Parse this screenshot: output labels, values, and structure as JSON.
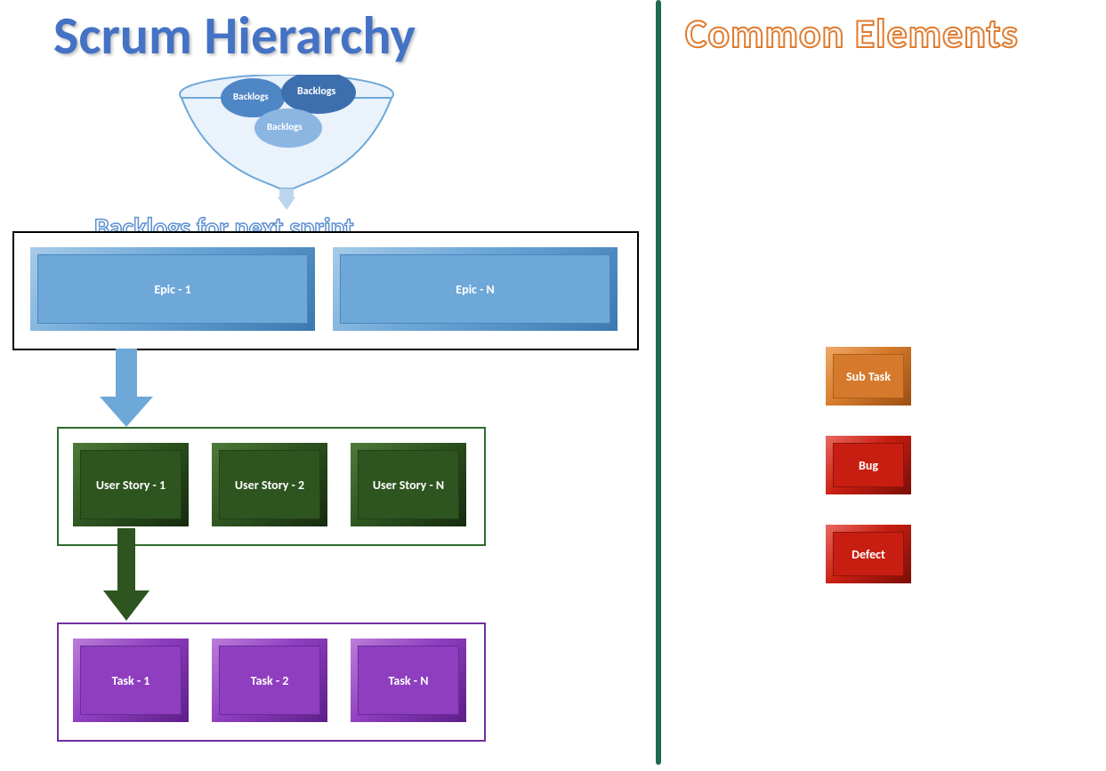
{
  "titles": {
    "left": "Scrum Hierarchy",
    "right": "Common Elements"
  },
  "funnel": {
    "b1": "Backlogs",
    "b2": "Backlogs",
    "b3": "Backlogs"
  },
  "labels": {
    "backlogs_line": "Backlogs for next sprint"
  },
  "epics": {
    "e1": "Epic - 1",
    "eN": "Epic - N"
  },
  "stories": {
    "s1": "User Story - 1",
    "s2": "User Story - 2",
    "sN": "User Story - N"
  },
  "tasks": {
    "t1": "Task - 1",
    "t2": "Task - 2",
    "tN": "Task - N"
  },
  "common": {
    "subtask": "Sub Task",
    "bug": "Bug",
    "defect": "Defect"
  },
  "colors": {
    "epic": "#6ea8d8",
    "story": "#2e5520",
    "task": "#8f3ec0",
    "subtask": "#d57a2c",
    "bug": "#c81e12",
    "defect": "#c81e12",
    "divider": "#1f6a54",
    "title_left": "#4472c4",
    "title_right_stroke": "#e07b2e"
  }
}
